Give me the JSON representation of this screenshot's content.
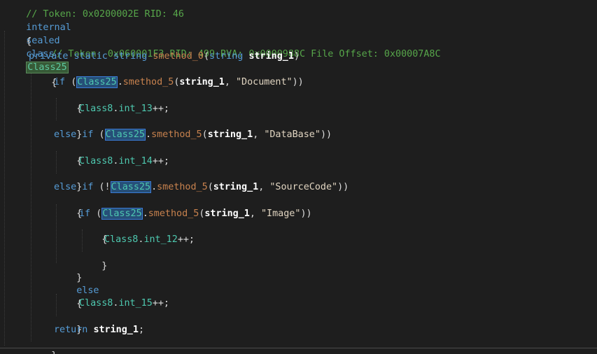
{
  "editor": {
    "lines": {
      "l0": {
        "comment": "// Token: 0x0200002E RID: 46"
      },
      "l1": {
        "kw1": "internal",
        "kw2": "sealed",
        "kw3": "class",
        "class_name": "Class25"
      },
      "l2": {
        "brace": "{"
      },
      "l3": {
        "comment": "// Token: 0x060001F3 RID: 499 RVA: 0x0000988C File Offset: 0x00007A8C"
      },
      "l4": {
        "kw1": "private",
        "kw2": "static",
        "kw3": "string",
        "method": "smethod_0",
        "open": "(",
        "ptype": "string",
        "param": "string_1",
        "close": ")"
      },
      "l5": {
        "brace": "{"
      },
      "l6": {
        "kw": "if",
        "open": "(",
        "cls": "Class25",
        "dot": ".",
        "method": "smethod_5",
        "open2": "(",
        "arg": "string_1",
        "comma": ", ",
        "str": "\"Document\"",
        "close": "))"
      },
      "l7": {
        "brace": "{"
      },
      "l8": {
        "cls": "Class8",
        "dot": ".",
        "field": "int_13",
        "rest": "++;"
      },
      "l9": {
        "brace": "}"
      },
      "l10": {
        "kw": "else if",
        "open": "(",
        "cls": "Class25",
        "dot": ".",
        "method": "smethod_5",
        "open2": "(",
        "arg": "string_1",
        "comma": ", ",
        "str": "\"DataBase\"",
        "close": "))"
      },
      "l11": {
        "brace": "{"
      },
      "l12": {
        "cls": "Class8",
        "dot": ".",
        "field": "int_14",
        "rest": "++;"
      },
      "l13": {
        "brace": "}"
      },
      "l14": {
        "kw": "else if",
        "open": "(!",
        "cls": "Class25",
        "dot": ".",
        "method": "smethod_5",
        "open2": "(",
        "arg": "string_1",
        "comma": ", ",
        "str": "\"SourceCode\"",
        "close": "))"
      },
      "l15": {
        "brace": "{"
      },
      "l16": {
        "kw": "if",
        "open": "(",
        "cls": "Class25",
        "dot": ".",
        "method": "smethod_5",
        "open2": "(",
        "arg": "string_1",
        "comma": ", ",
        "str": "\"Image\"",
        "close": "))"
      },
      "l17": {
        "brace": "{"
      },
      "l18": {
        "cls": "Class8",
        "dot": ".",
        "field": "int_12",
        "rest": "++;"
      },
      "l19": {
        "brace": "}"
      },
      "l20": {
        "brace": "}"
      },
      "l21": {
        "kw": "else"
      },
      "l22": {
        "brace": "{"
      },
      "l23": {
        "cls": "Class8",
        "dot": ".",
        "field": "int_15",
        "rest": "++;"
      },
      "l24": {
        "brace": "}"
      },
      "l25": {
        "kw": "return",
        "value": "string_1",
        "semi": ";"
      },
      "l26": {
        "brace": "}"
      }
    }
  }
}
